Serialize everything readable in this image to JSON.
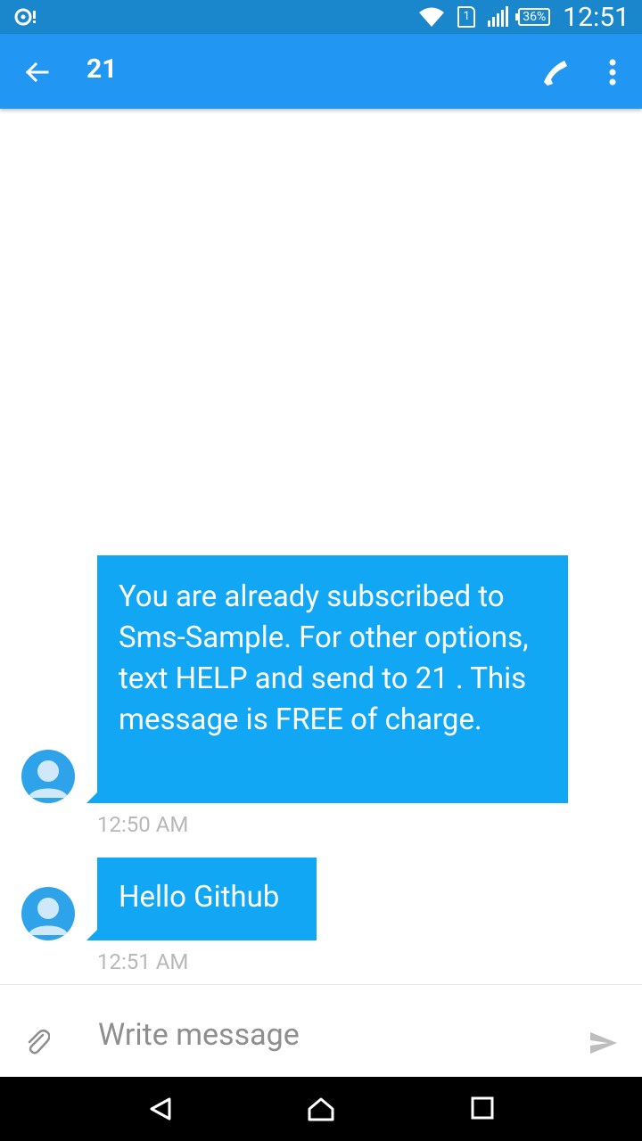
{
  "status_bar": {
    "battery": "36%",
    "time": "12:51",
    "sim": "1",
    "icons": [
      "notification-icon",
      "wifi-icon",
      "sim-icon",
      "signal-icon",
      "battery-icon"
    ]
  },
  "app_bar": {
    "title": "21",
    "icons": [
      "back-arrow-icon",
      "phone-icon",
      "more-vert-icon"
    ]
  },
  "messages": [
    {
      "text": "You are already subscribed to Sms-Sample. For other options, text HELP and send to 21        . This message is FREE of charge.",
      "time": "12:50 AM"
    },
    {
      "text": "Hello Github",
      "time": "12:51 AM"
    }
  ],
  "composer": {
    "placeholder": "Write message",
    "value": ""
  },
  "colors": {
    "status_bar": "#1a86cc",
    "app_bar": "#2196f3",
    "bubble": "#12a7f5",
    "timestamp": "#b8b8b8"
  }
}
